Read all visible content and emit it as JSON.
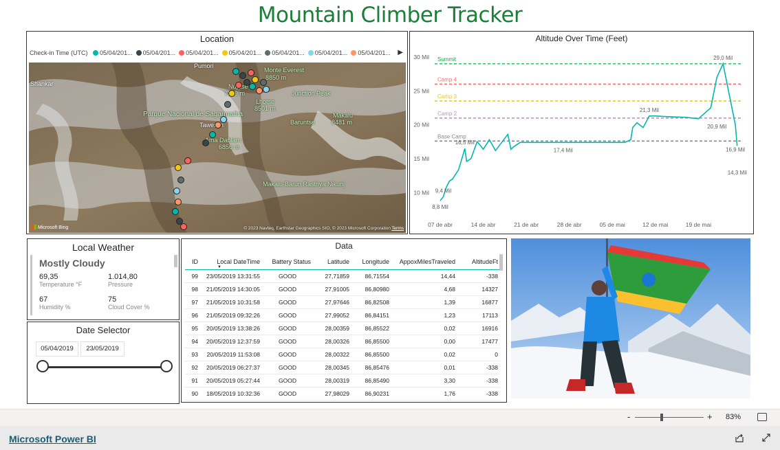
{
  "page": {
    "title": "Mountain Climber Tracker"
  },
  "map": {
    "title": "Location",
    "legend_label": "Check-in Time (UTC)",
    "legend_items": [
      {
        "label": "05/04/201...",
        "color": "#01b8aa"
      },
      {
        "label": "05/04/201...",
        "color": "#374649"
      },
      {
        "label": "05/04/201...",
        "color": "#fd625e"
      },
      {
        "label": "05/04/201...",
        "color": "#f2c80f"
      },
      {
        "label": "05/04/201...",
        "color": "#5f6b6d"
      },
      {
        "label": "05/04/201...",
        "color": "#8ad4eb"
      },
      {
        "label": "05/04/201...",
        "color": "#fe9666"
      }
    ],
    "labels": {
      "shankar": "Shankar",
      "pumori": "Pumori",
      "everest": "Monte Everest",
      "everest_h": "8850 m",
      "nuptse": "Nuptse",
      "nuptse_h": "7879 m",
      "lhotse": "Lhotse",
      "lhotse_h": "8501 m",
      "junction": "Junction Peak",
      "parque": "Parque Nacional de Sagarmatha",
      "tawesch": "Tawesch",
      "baruntse": "Baruntse",
      "makalu": "Makalu",
      "makalu_h": "8481 m",
      "ama": "Ama Dablam",
      "ama_h": "6856 m",
      "barun": "Makalu-Barun Rastriya Nikunj",
      "bing": "Microsoft Bing",
      "copyright": "© 2023 Navteq, Earthstar Geographics SIO, © 2023 Microsoft Corporation",
      "terms": "Terms"
    }
  },
  "altitude": {
    "title": "Altitude Over Time (Feet)",
    "camps": {
      "summit": "Summit",
      "camp4": "Camp 4",
      "camp3": "Camp 3",
      "camp2": "Camp 2",
      "base": "Base Camp"
    }
  },
  "chart_data": {
    "type": "line",
    "title": "Altitude Over Time (Feet)",
    "x_ticks": [
      "07 de abr",
      "14 de abr",
      "21 de abr",
      "28 de abr",
      "05 de mai",
      "12 de mai",
      "19 de mai"
    ],
    "y_ticks": [
      "10 Mil",
      "15 Mil",
      "20 Mil",
      "25 Mil",
      "30 Mil"
    ],
    "ylim": [
      7000,
      30500
    ],
    "reference_lines": [
      {
        "name": "Summit",
        "value": 29000,
        "color": "#2ecc71"
      },
      {
        "name": "Camp 4",
        "value": 26000,
        "color": "#fd6e6a"
      },
      {
        "name": "Camp 3",
        "value": 23500,
        "color": "#f2c80f"
      },
      {
        "name": "Camp 2",
        "value": 21000,
        "color": "#c88ec8"
      },
      {
        "name": "Base Camp",
        "value": 17600,
        "color": "#888888"
      }
    ],
    "series": [
      {
        "color": "#01b8aa",
        "x_days": [
          0,
          0.5,
          1,
          1.5,
          2,
          3,
          4,
          4.3,
          5,
          6,
          6.5,
          7,
          8,
          9,
          10,
          11,
          11.5,
          12,
          13,
          14,
          17,
          18,
          20,
          21,
          23,
          25,
          28,
          30,
          31,
          31.3,
          32,
          33,
          34,
          35,
          37,
          40,
          41,
          42,
          44,
          45,
          46,
          47,
          48,
          48.3
        ],
        "y": [
          8800,
          9400,
          10800,
          11700,
          12000,
          13400,
          16500,
          14600,
          15000,
          17500,
          17000,
          16400,
          17800,
          16200,
          17400,
          18600,
          16400,
          16800,
          17400,
          17400,
          17400,
          17400,
          17400,
          17400,
          17400,
          17400,
          17400,
          17400,
          17800,
          19600,
          20300,
          19600,
          21300,
          21300,
          21200,
          21100,
          21000,
          20900,
          22500,
          27000,
          29000,
          24500,
          20000,
          16900,
          16800,
          14300
        ]
      }
    ],
    "data_labels": [
      {
        "text": "8,8 Mil"
      },
      {
        "text": "9,4 Mil"
      },
      {
        "text": "16,5 Mil"
      },
      {
        "text": "17,4 Mil"
      },
      {
        "text": "21,3 Mil"
      },
      {
        "text": "20,9 Mil"
      },
      {
        "text": "29,0 Mil"
      },
      {
        "text": "16,9 Mil"
      },
      {
        "text": "14,3 Mil"
      }
    ]
  },
  "weather": {
    "title": "Local Weather",
    "condition": "Mostly Cloudy",
    "temp": "69,35",
    "temp_label": "Temperature °F",
    "pressure": "1.014,80",
    "pressure_label": "Pressure",
    "humidity": "67",
    "humidity_label": "Humidity %",
    "cloud": "75",
    "cloud_label": "Cloud Cover %"
  },
  "date_selector": {
    "title": "Date Selector",
    "start": "05/04/2019",
    "end": "23/05/2019"
  },
  "table": {
    "title": "Data",
    "headers": [
      "ID",
      "Local DateTime",
      "Battery Status",
      "Latitude",
      "Longitude",
      "AppoxMilesTraveled",
      "AltitudeFt"
    ],
    "rows": [
      [
        "99",
        "23/05/2019 13:31:55",
        "GOOD",
        "27,71859",
        "86,71554",
        "14,44",
        "-338"
      ],
      [
        "98",
        "21/05/2019 14:30:05",
        "GOOD",
        "27,91005",
        "86,80980",
        "4,68",
        "14327"
      ],
      [
        "97",
        "21/05/2019 10:31:58",
        "GOOD",
        "27,97646",
        "86,82508",
        "1,39",
        "16877"
      ],
      [
        "96",
        "21/05/2019 09:32:26",
        "GOOD",
        "27,99052",
        "86,84151",
        "1,23",
        "17113"
      ],
      [
        "95",
        "20/05/2019 13:38:26",
        "GOOD",
        "28,00359",
        "86,85522",
        "0,02",
        "16916"
      ],
      [
        "94",
        "20/05/2019 12:37:59",
        "GOOD",
        "28,00326",
        "86,85500",
        "0,00",
        "17477"
      ],
      [
        "93",
        "20/05/2019 11:53:08",
        "GOOD",
        "28,00322",
        "86,85500",
        "0,02",
        "0"
      ],
      [
        "92",
        "20/05/2019 06:27:37",
        "GOOD",
        "28,00345",
        "86,85476",
        "0,01",
        "-338"
      ],
      [
        "91",
        "20/05/2019 05:27:44",
        "GOOD",
        "28,00319",
        "86,85490",
        "3,30",
        "-338"
      ],
      [
        "90",
        "18/05/2019 10:32:36",
        "GOOD",
        "27,98029",
        "86,90231",
        "1,76",
        "-338"
      ]
    ]
  },
  "statusbar": {
    "zoom_minus": "-",
    "zoom_plus": "+",
    "zoom": "83%"
  },
  "footer": {
    "link": "Microsoft Power BI"
  }
}
